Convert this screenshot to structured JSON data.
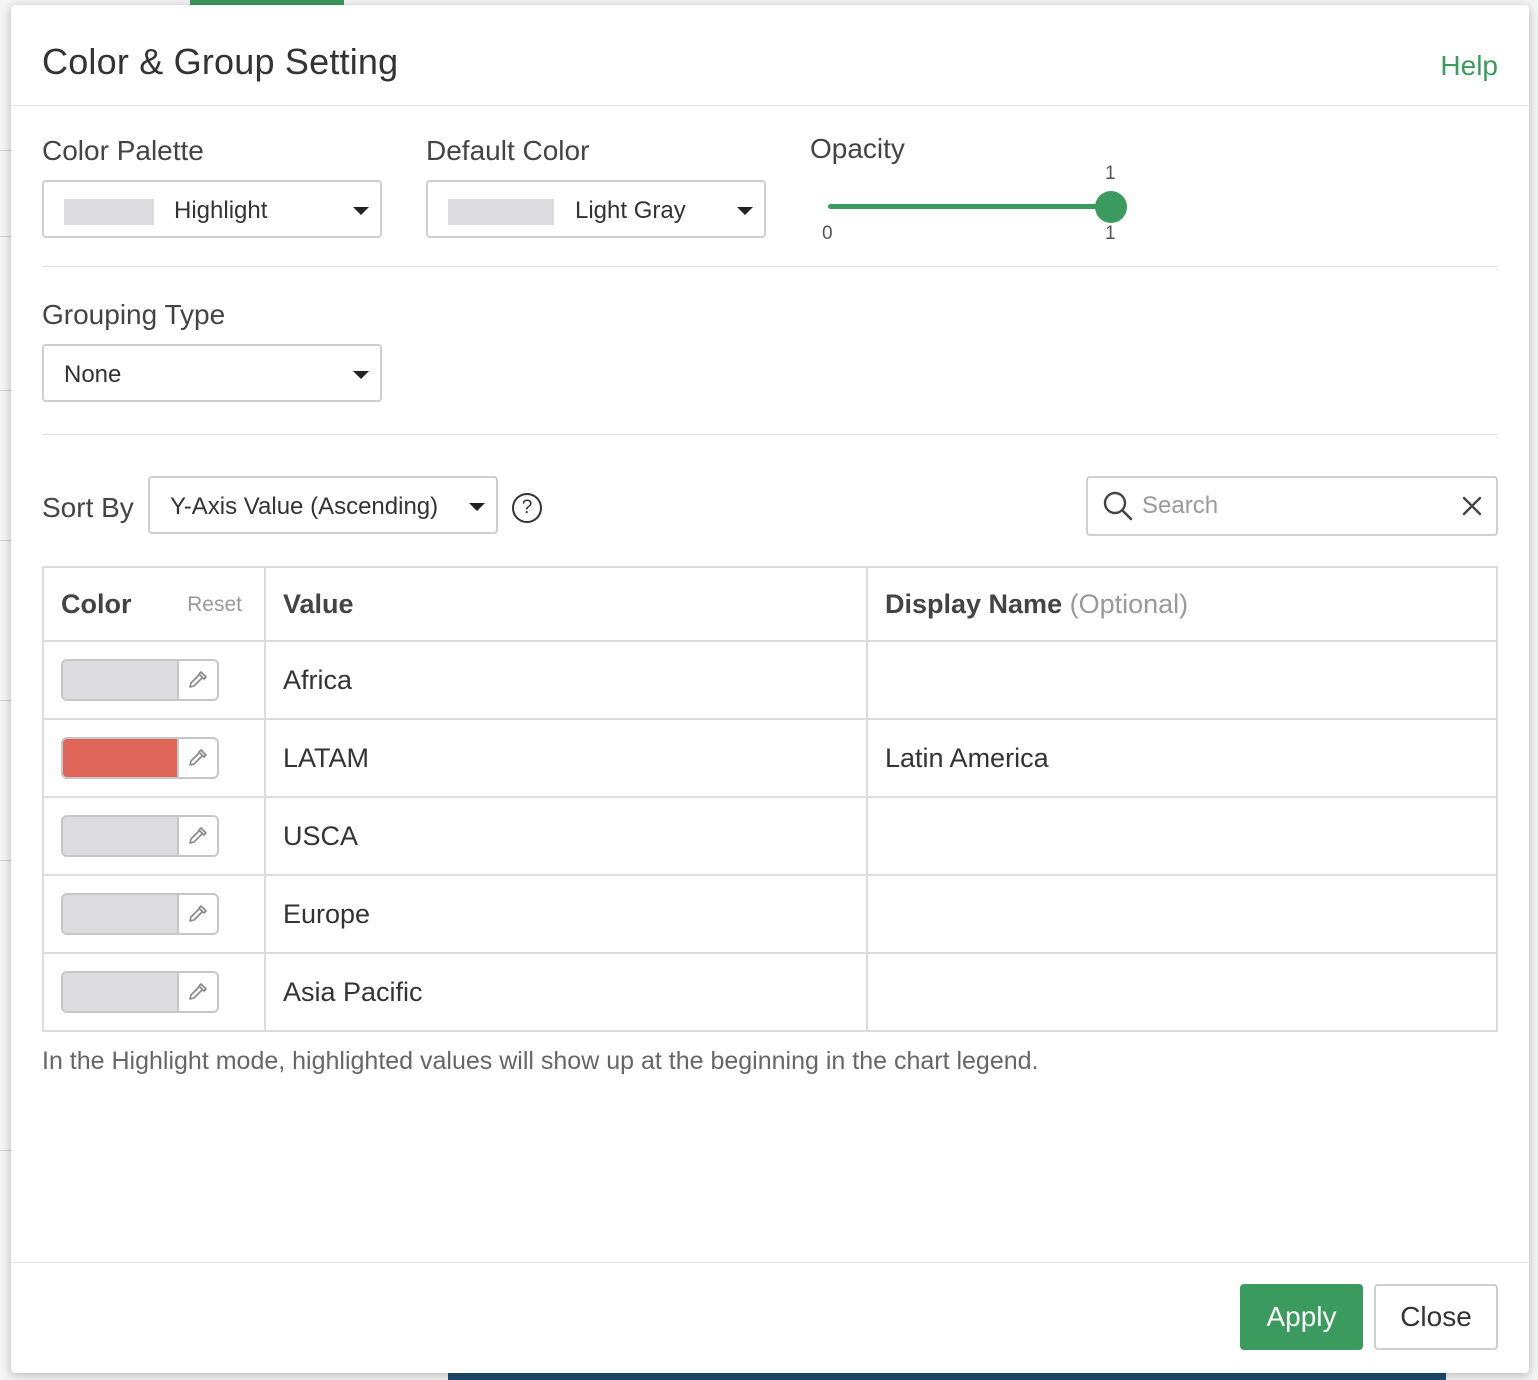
{
  "dialog": {
    "title": "Color & Group Setting",
    "help_label": "Help"
  },
  "color_palette": {
    "label": "Color Palette",
    "value": "Highlight",
    "swatch_color": "#dcdcdf"
  },
  "default_color": {
    "label": "Default Color",
    "value": "Light Gray",
    "swatch_color": "#dcdcdf"
  },
  "opacity": {
    "label": "Opacity",
    "value": "1",
    "min": "0",
    "max": "1"
  },
  "grouping_type": {
    "label": "Grouping Type",
    "value": "None"
  },
  "sort": {
    "label": "Sort By",
    "value": "Y-Axis Value (Ascending)",
    "help_glyph": "?"
  },
  "search": {
    "placeholder": "Search",
    "value": ""
  },
  "table": {
    "color_header": "Color",
    "reset_label": "Reset",
    "value_header": "Value",
    "display_name_header": "Display Name",
    "display_name_optional": "(Optional)",
    "rows": [
      {
        "color": "#dcdcdf",
        "value": "Africa",
        "display_name": ""
      },
      {
        "color": "#e06559",
        "value": "LATAM",
        "display_name": "Latin America"
      },
      {
        "color": "#dcdcdf",
        "value": "USCA",
        "display_name": ""
      },
      {
        "color": "#dcdcdf",
        "value": "Europe",
        "display_name": ""
      },
      {
        "color": "#dcdcdf",
        "value": "Asia Pacific",
        "display_name": ""
      }
    ]
  },
  "note": "In the Highlight mode, highlighted values will show up at the beginning in the chart legend.",
  "footer": {
    "apply_label": "Apply",
    "close_label": "Close"
  },
  "colors": {
    "accent": "#3b9a5e",
    "highlight": "#e06559",
    "light_gray": "#dcdcdf"
  }
}
